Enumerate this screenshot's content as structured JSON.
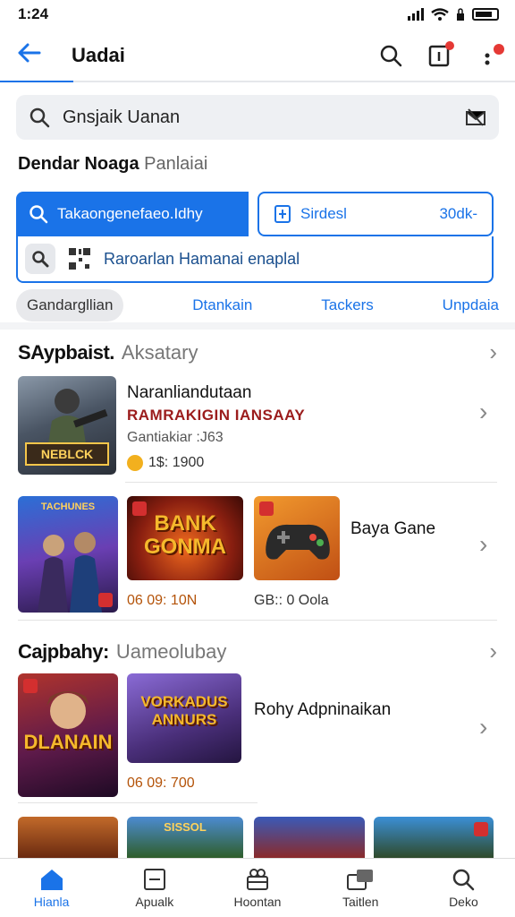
{
  "status": {
    "time": "1:24"
  },
  "header": {
    "title": "Uadai"
  },
  "search": {
    "query": "Gnsjaik Uanan"
  },
  "section": {
    "title": "Dendar Noaga",
    "subtitle": "Panlaiai"
  },
  "chips": {
    "primary": "Takaongenefaeo.Idhy",
    "secondary": "Sirdesl",
    "secondary_value": "30dk-",
    "filter": "Raroarlan Hamanai enaplal"
  },
  "tabs": [
    "Gandargllian",
    "Dtankain",
    "Tackers",
    "Unpdaia"
  ],
  "category1": {
    "title": "SAypbaist.",
    "subtitle": "Aksatary",
    "featured": {
      "title": "Naranliandutaan",
      "subtitle": "RAMRAKIGIN IANSAAY",
      "meta": "Gantiakiar :J63",
      "price": "1$: 1900",
      "cover_label": "NEBLCK"
    },
    "grid": {
      "cover2_top": "TACHUNES",
      "cover3": "BANK GONMA",
      "label_left": "06 09: 10N",
      "label_right": "GB:: 0 Oola",
      "side_title": "Baya Gane"
    }
  },
  "category2": {
    "title": "Cajpbahy:",
    "subtitle": "Uameolubay",
    "cover1": "DLANAIN",
    "cover2": "VORKADUS ANNURS",
    "price": "06 09: 700",
    "side_title": "Rohy Adpninaikan"
  },
  "strip": {
    "cover2": "SISSOL"
  },
  "bottom_nav": [
    "Hianla",
    "Apualk",
    "Hoontan",
    "Taitlen",
    "Deko"
  ],
  "colors": {
    "accent": "#1a73e8",
    "price": "#b45309",
    "subtitle_red": "#9b1c1c"
  }
}
